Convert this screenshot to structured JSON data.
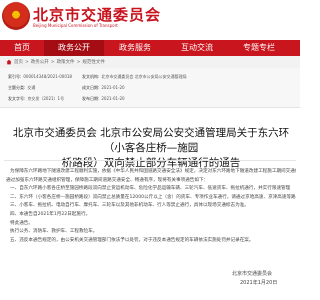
{
  "header": {
    "site_title": "北京市交通委员会",
    "site_subtitle": "Beijing Municipal Commission of Transport"
  },
  "nav": {
    "items": [
      "首页",
      "政务公开",
      "政务服务",
      "互动交流",
      "专题专栏"
    ],
    "active_index": 1
  },
  "breadcrumb": {
    "items": [
      "首页",
      "政务公开",
      "政策文件",
      "规范性文件"
    ]
  },
  "meta": {
    "index_label": "索引号:",
    "index_value": "000014348/2021-00018",
    "category_label": "主题分类:",
    "category_value": "交通",
    "issuer_label": "发文机构:",
    "issuer_value": "北京市交通委员会 北京市公安局公安交通管理局",
    "date_label": "成文日期:",
    "date_value": "2021-01-20",
    "docno_label": "发文字号:",
    "docno_value": "京交发〔2021〕1号",
    "pubdate_label": "发布日期:",
    "pubdate_value": "2021-01-20"
  },
  "title": {
    "line1": "北京市交通委员会 北京市公安局公安交通管理局关于东六环（小客各庄桥—施园",
    "line2": "桥路段）双向禁止部分车辆通行的通告"
  },
  "body": {
    "paragraphs": [
      "为保障东六环路地下隧道改建工程顺利实施，依据《中华人民共和国道路交通安全法》规定，决定对东六环路地下隧道改建工程施工期间交通组织",
      "通过加强东六环路交通组织管理，保障施工期间道路交通安全、畅通有序，现将有关事项通告如下：",
      "一、自东六环路小客各庄桥至施园桥路段双向禁止货运机动车、危险化学品运输车辆、三轮汽车、低速货车、拖拉机通行，并实行限速管理",
      "二、东六环（小客各庄桥—施园桥路段）双向禁止总质量在12000公斤以上（含）的货车、专项作业车通行，请通过京哈高速、京津高速等路段",
      "三、小客车、拖拉机、电动自行车、摩托车、三轮车以及其他非机动车、行人等禁止通行，具体以现场交通标志为准。",
      "四、本通告自2021年1月22日起施行。",
      "特此通告。",
      "执行公务、消防车、救护车、工程救险车。",
      "五、违反本通告规定的，由公安机关交通管理部门依法予以处罚，对于违反本通告规定的车辆依法实施处罚并记录在案。"
    ]
  },
  "footer": {
    "org": "北京市交通委员会",
    "date": "2021年1月20日"
  }
}
